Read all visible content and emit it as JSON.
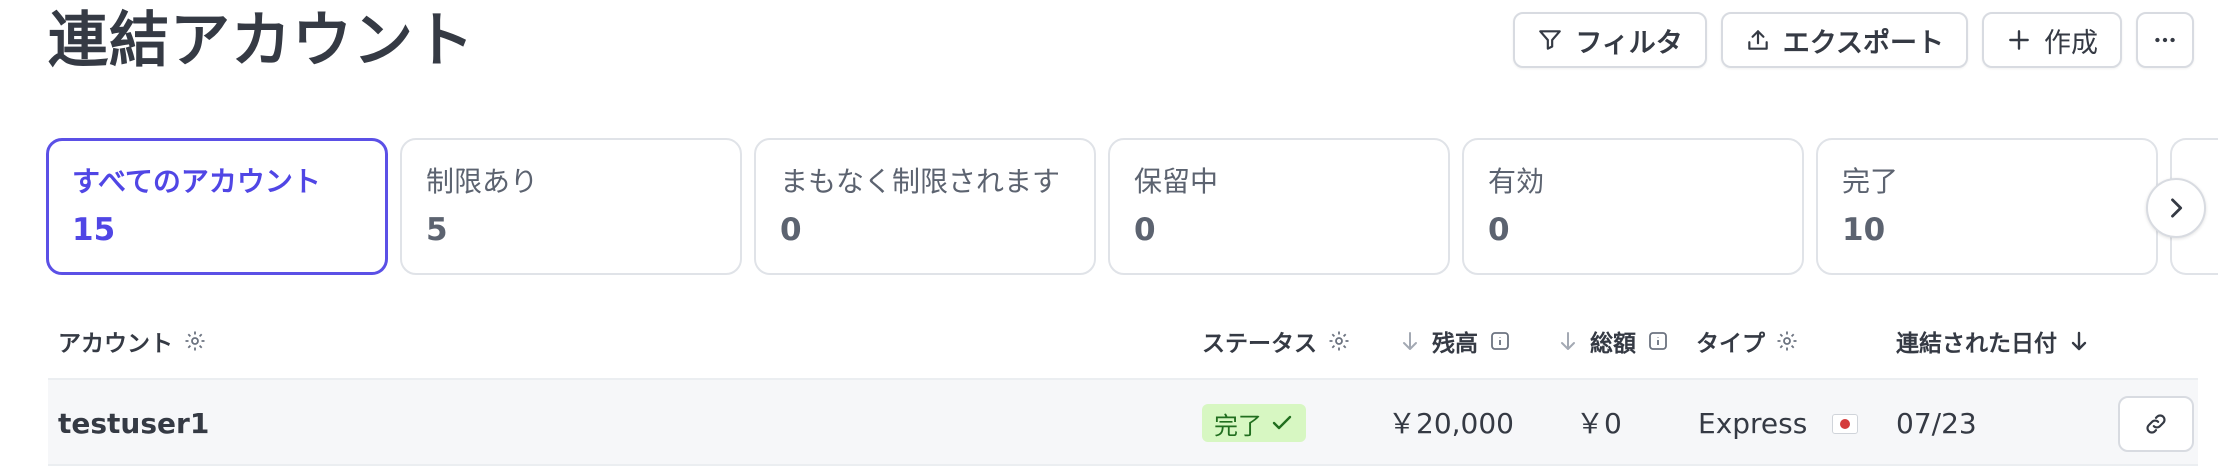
{
  "header": {
    "title": "連結アカウント",
    "filter_label": "フィルタ",
    "export_label": "エクスポート",
    "create_label": "作成"
  },
  "cards": [
    {
      "label": "すべてのアカウント",
      "count": "15"
    },
    {
      "label": "制限あり",
      "count": "5"
    },
    {
      "label": "まもなく制限されます",
      "count": "0"
    },
    {
      "label": "保留中",
      "count": "0"
    },
    {
      "label": "有効",
      "count": "0"
    },
    {
      "label": "完了",
      "count": "10"
    }
  ],
  "table": {
    "columns": {
      "account": "アカウント",
      "status": "ステータス",
      "balance": "残高",
      "total": "総額",
      "type": "タイプ",
      "linked_date": "連結された日付"
    },
    "rows": [
      {
        "account": "testuser1",
        "status": "完了",
        "balance": "￥20,000",
        "total": "￥0",
        "type": "Express",
        "linked_date": "07/23"
      }
    ]
  },
  "colors": {
    "accent": "#5046e5",
    "success_bg": "#d7f7c2",
    "success_text": "#216e1f"
  }
}
